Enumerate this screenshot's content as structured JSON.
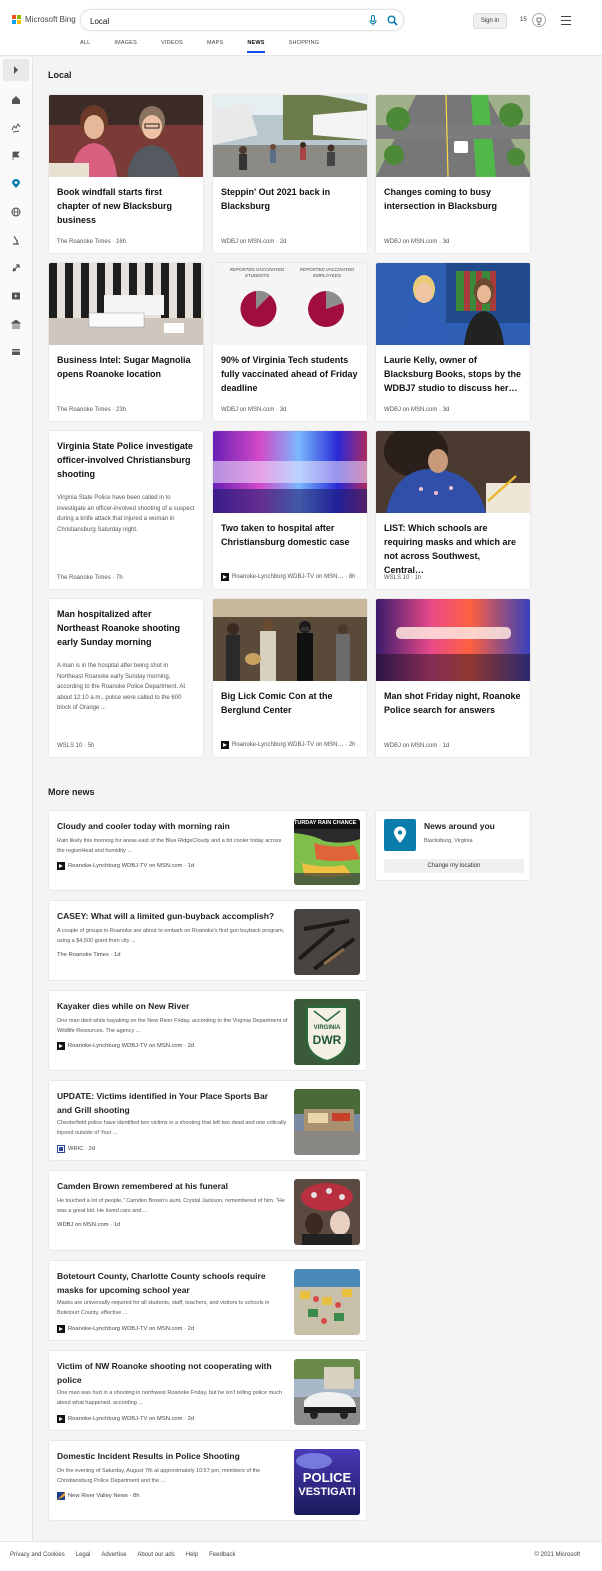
{
  "header": {
    "logo_text": "Microsoft Bing",
    "search_value": "Local",
    "signin_label": "Sign in",
    "rewards_count": "15",
    "tabs": [
      "ALL",
      "IMAGES",
      "VIDEOS",
      "MAPS",
      "NEWS",
      "SHOPPING"
    ],
    "active_tab": "NEWS"
  },
  "local": {
    "title": "Local",
    "cards": [
      {
        "title": "Book windfall starts first chapter of new Blacksburg business",
        "source": "The Roanoke Times",
        "time": "16h"
      },
      {
        "title": "Steppin' Out 2021 back in Blacksburg",
        "source": "WDBJ on MSN.com",
        "time": "2d"
      },
      {
        "title": "Changes coming to busy intersection in Blacksburg",
        "source": "WDBJ on MSN.com",
        "time": "3d"
      },
      {
        "title": "Business Intel: Sugar Magnolia opens Roanoke location",
        "source": "The Roanoke Times",
        "time": "23h"
      },
      {
        "title": "90% of Virginia Tech students fully vaccinated ahead of Friday deadline",
        "source": "WDBJ on MSN.com",
        "time": "3d",
        "image_labels": [
          "REPORTED VACCINATED STUDENTS",
          "REPORTED VACCINATED EMPLOYEES"
        ]
      },
      {
        "title": "Laurie Kelly, owner of Blacksburg Books, stops by the WDBJ7 studio to discuss her…",
        "source": "WDBJ on MSN.com",
        "time": "3d"
      },
      {
        "title": "Virginia State Police investigate officer-involved Christiansburg shooting",
        "desc": "Virginia State Police have been called in to investigate an officer-involved shooting of a suspect during a knife attack that injured a woman in Christiansburg Saturday night.",
        "source": "The Roanoke Times",
        "time": "7h"
      },
      {
        "title": "Two taken to hospital after Christiansburg domestic case",
        "source": "Roanoke-Lynchburg WDBJ-TV on MSN…",
        "time": "8h"
      },
      {
        "title": "LIST: Which schools are requiring masks and which are not across Southwest, Central…",
        "source": "WSLS 10",
        "time": "1h"
      },
      {
        "title": "Man hospitalized after Northeast Roanoke shooting early Sunday morning",
        "desc": "A man is in the hospital after being shot in Northeast Roanoke early Sunday morning, according to the Roanoke Police Department. At about 12:10 a.m., police were called to the 600 block of Orange ...",
        "source": "WSLS 10",
        "time": "5h"
      },
      {
        "title": "Big Lick Comic Con at the Berglund Center",
        "source": "Roanoke-Lynchburg WDBJ-TV on MSN…",
        "time": "2h"
      },
      {
        "title": "Man shot Friday night, Roanoke Police search for answers",
        "source": "WDBJ on MSN.com",
        "time": "1d"
      }
    ]
  },
  "more_news": {
    "title": "More news",
    "items": [
      {
        "title": "Cloudy and cooler today with morning rain",
        "desc": "Rain likely this morning for areas east of the Blue RidgeCloudy and a bit cooler today across the regionHeat and humidity ...",
        "source": "Roanoke-Lynchburg WDBJ-TV on MSN.com",
        "time": "1d",
        "thumb_text": "TURDAY RAIN CHANCE"
      },
      {
        "title": "CASEY: What will a limited gun-buyback accomplish?",
        "desc": "A couple of groups in Roanoke are about to embark on Roanoke's first gun buyback program, using a $4,500 grant from city ...",
        "source": "The Roanoke Times",
        "time": "1d"
      },
      {
        "title": "Kayaker dies while on New River",
        "desc": "One man died while kayaking on the New River Friday, according to the Virginia Department of Wildlife Resources. The agency ...",
        "source": "Roanoke-Lynchburg WDBJ-TV on MSN.com",
        "time": "2d",
        "thumb_text": [
          "VIRGINIA",
          "DWR"
        ]
      },
      {
        "title": "UPDATE: Victims identified in Your Place Sports Bar and Grill shooting",
        "desc": "Chesterfield police have identified two victims in a shooting that left two dead and one critically injured outside of Your ...",
        "source": "WRIC",
        "time": "2d"
      },
      {
        "title": "Camden Brown remembered at his funeral",
        "desc": "He touched a lot of people,\" Camden Brown's aunt, Crystal Jackson, remembered of him. \"He was a great kid. He loved cars and ...",
        "source": "WDBJ on MSN.com",
        "time": "1d"
      },
      {
        "title": "Botetourt County, Charlotte County schools require masks for upcoming school year",
        "desc": "Masks are universally required for all students, staff, teachers, and visitors to schools in Botetourt County, effective ...",
        "source": "Roanoke-Lynchburg WDBJ-TV on MSN.com",
        "time": "2d"
      },
      {
        "title": "Victim of NW Roanoke shooting not cooperating with police",
        "desc": "One man was hurt in a shooting in northwest Roanoke Friday, but he isn't telling police much about what happened. according ...",
        "source": "Roanoke-Lynchburg WDBJ-TV on MSN.com",
        "time": "2d"
      },
      {
        "title": "Domestic Incident Results in Police Shooting",
        "desc": "On the evening of Saturday, August 7th at approximately 10:57 pm, members of the Christiansburg Police Department and the ...",
        "source": "New River Valley News",
        "time": "8h",
        "thumb_text": [
          "POLICE",
          "VESTIGATI"
        ]
      }
    ]
  },
  "around": {
    "title": "News around you",
    "location": "Blacksburg, Virginia",
    "button": "Change my location"
  },
  "footer": {
    "links": [
      "Privacy and Cookies",
      "Legal",
      "Advertise",
      "About our ads",
      "Help",
      "Feedback"
    ],
    "copyright": "© 2021 Microsoft"
  },
  "colors": {
    "accent": "#007daa",
    "tab_underline": "#174ae4"
  },
  "icons": [
    "expand-icon",
    "home-icon",
    "us-icon",
    "flag-icon",
    "location-icon",
    "globe-icon",
    "science-icon",
    "sports-icon",
    "entertainment-icon",
    "politics-icon",
    "money-icon"
  ]
}
